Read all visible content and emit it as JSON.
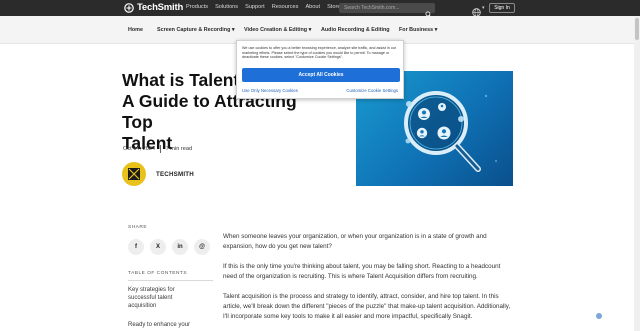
{
  "topbar": {
    "brand": "TechSmith",
    "nav": [
      "Products",
      "Solutions",
      "Support",
      "Resources",
      "About",
      "Store"
    ],
    "search_placeholder": "Search TechSmith.com...",
    "signin": "Sign In"
  },
  "mainnav": {
    "items": [
      "Home",
      "Screen Capture & Recording ▾",
      "Video Creation & Editing ▾",
      "Audio Recording & Editing",
      "For Business ▾"
    ]
  },
  "cookie": {
    "text": "We use cookies to offer you a better browsing experience, analyze site traffic, and assist in our marketing efforts. Please select the type of cookies you would like to permit. To manage or deactivate these cookies, select \"Customize Cookie Settings\".",
    "accept": "Accept All Cookies",
    "necessary": "Use Only Necessary Cookies",
    "customize": "Customize Cookie Settings"
  },
  "article": {
    "title_line1": "What is Talent",
    "title_line2": "A Guide to Attracting Top",
    "title_line3": "Talent",
    "date": "Oct 14, 2024",
    "read_time": "7 min read",
    "author": "TECHSMITH"
  },
  "sidebar": {
    "share_label": "SHARE",
    "share_icons": [
      "facebook-icon",
      "x-icon",
      "linkedin-icon",
      "email-icon"
    ],
    "toc_label": "TABLE OF CONTENTS",
    "toc_items": [
      "Key strategies for successful talent acquisition",
      "Ready to enhance your"
    ]
  },
  "body": {
    "p1": "When someone leaves your organization, or when your organization is in a state of growth and expansion, how do you get new talent?",
    "p2": "If this is the only time you're thinking about talent, you may be falling short. Reacting to a headcount need of the organization is recruiting. This is where Talent Acquisition differs from recruiting.",
    "p3": "Talent acquisition is the process and strategy to identify, attract, consider, and hire top talent. In this article, we'll break down the different \"pieces of the puzzle\" that make-up talent acquisition. Additionally, I'll incorporate some key tools to make it all easier and more impactful, specifically Snagit."
  },
  "colors": {
    "accept_button": "#1e6fd8",
    "hero_bg": "#0f72b5",
    "avatar_bg": "#e8c21a"
  }
}
